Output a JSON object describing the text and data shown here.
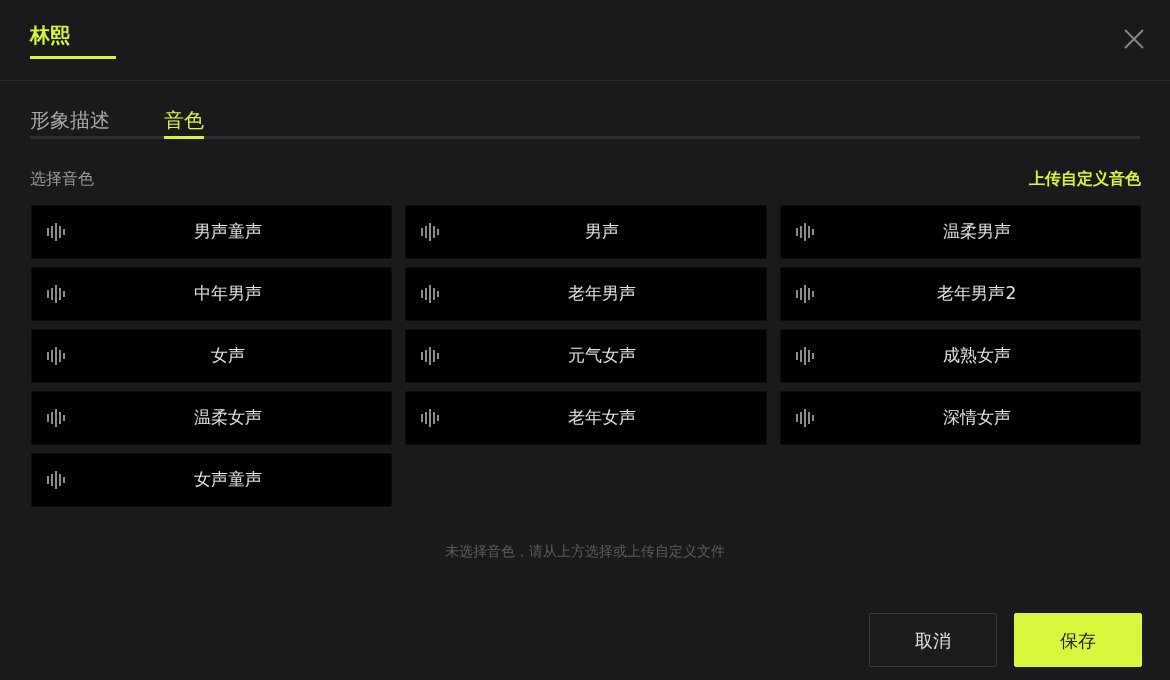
{
  "dialog": {
    "title": "林熙"
  },
  "tabs": [
    {
      "label": "形象描述",
      "selected": false
    },
    {
      "label": "音色",
      "selected": true
    }
  ],
  "voice_section": {
    "label": "选择音色",
    "upload_link": "上传自定义音色"
  },
  "voices": [
    {
      "name": "男声童声"
    },
    {
      "name": "男声"
    },
    {
      "name": "温柔男声"
    },
    {
      "name": "中年男声"
    },
    {
      "name": "老年男声"
    },
    {
      "name": "老年男声2"
    },
    {
      "name": "女声"
    },
    {
      "name": "元气女声"
    },
    {
      "name": "成熟女声"
    },
    {
      "name": "温柔女声"
    },
    {
      "name": "老年女声"
    },
    {
      "name": "深情女声"
    },
    {
      "name": "女声童声"
    }
  ],
  "empty_hint": "未选择音色，请从上方选择或上传自定义文件",
  "buttons": [
    {
      "label": "取消",
      "kind": "secondary"
    },
    {
      "label": "保存",
      "kind": "primary"
    }
  ]
}
